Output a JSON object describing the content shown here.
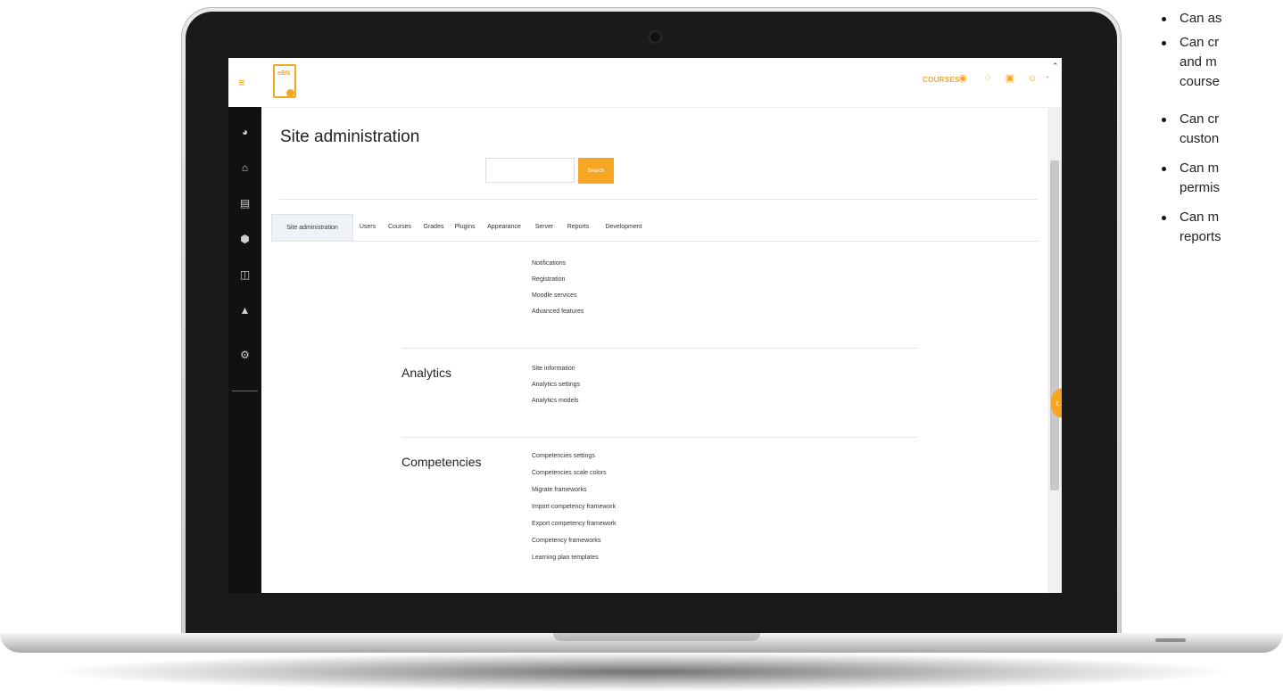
{
  "app": {
    "header": {
      "courses_label": "COURSES",
      "logo_text": "eBN"
    },
    "title": "Site administration",
    "search": {
      "value": "",
      "button_label": "Search"
    },
    "tabs": [
      {
        "label": "Site administration",
        "active": true
      },
      {
        "label": "Users"
      },
      {
        "label": "Courses"
      },
      {
        "label": "Grades"
      },
      {
        "label": "Plugins"
      },
      {
        "label": "Appearance"
      },
      {
        "label": "Server"
      },
      {
        "label": "Reports"
      },
      {
        "label": "Development"
      }
    ],
    "general_links": [
      "Notifications",
      "Registration",
      "Moodle services",
      "Advanced features"
    ],
    "analytics": {
      "heading": "Analytics",
      "links": [
        "Site information",
        "Analytics settings",
        "Analytics models"
      ]
    },
    "competencies": {
      "heading": "Competencies",
      "links": [
        "Competencies settings",
        "Competencies scale colors",
        "Migrate frameworks",
        "Import competency framework",
        "Export competency framework",
        "Competency frameworks",
        "Learning plan templates"
      ]
    },
    "sidebar_icons": [
      "dashboard-icon",
      "home-icon",
      "calendar-icon",
      "badge-icon",
      "files-icon",
      "graduation-icon",
      "settings-icon"
    ],
    "accent_color": "#f5a623"
  },
  "bullet_list": [
    [
      "Can as"
    ],
    [
      "Can cr",
      "and m",
      "course"
    ],
    [
      "Can cr",
      "custon"
    ],
    [
      "Can m",
      "permis"
    ],
    [
      "Can m",
      "reports"
    ]
  ]
}
